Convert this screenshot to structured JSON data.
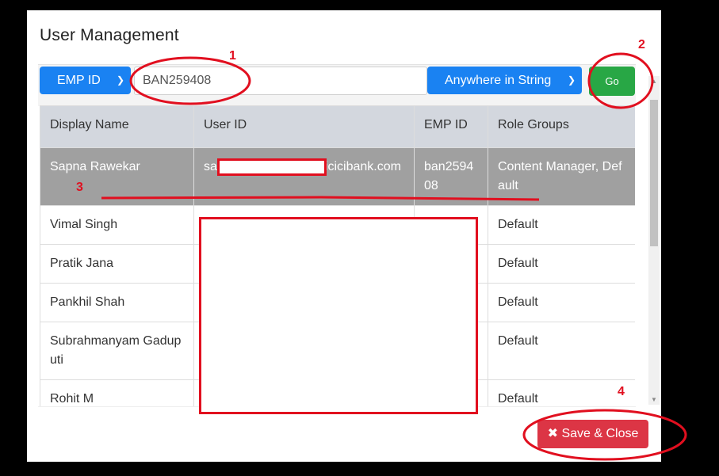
{
  "modal": {
    "title": "User Management"
  },
  "filter": {
    "field_select": "EMP ID",
    "search_value": "BAN259408",
    "match_select": "Anywhere in String",
    "go_label": "Go"
  },
  "table": {
    "headers": [
      "Display Name",
      "User ID",
      "EMP ID",
      "Role Groups"
    ],
    "rows": [
      {
        "name": "Sapna Rawekar",
        "user_id_start": "sa",
        "user_id_end": "icicibank.com",
        "emp_id": "ban259408",
        "roles": "Content Manager, Default"
      },
      {
        "name": "Vimal Singh",
        "user_id": "",
        "emp_id": "",
        "roles": "Default"
      },
      {
        "name": "Pratik Jana",
        "user_id": "",
        "emp_id": "",
        "roles": "Default"
      },
      {
        "name": "Pankhil Shah",
        "user_id": "",
        "emp_id": "",
        "roles": "Default"
      },
      {
        "name": "Subrahmanyam Gaduputi",
        "user_id": "",
        "emp_id": "",
        "roles": "Default"
      },
      {
        "name": "Rohit M",
        "user_id": "",
        "emp_id": "",
        "roles": "Default"
      }
    ]
  },
  "footer": {
    "save_close_label": "Save & Close",
    "save_icon": "close-icon"
  },
  "annotations": [
    "1",
    "2",
    "3",
    "4"
  ],
  "colors": {
    "accent_blue": "#1a82f2",
    "go_green": "#28a745",
    "danger_red": "#dc3545",
    "annotation_red": "#e10f1f"
  }
}
